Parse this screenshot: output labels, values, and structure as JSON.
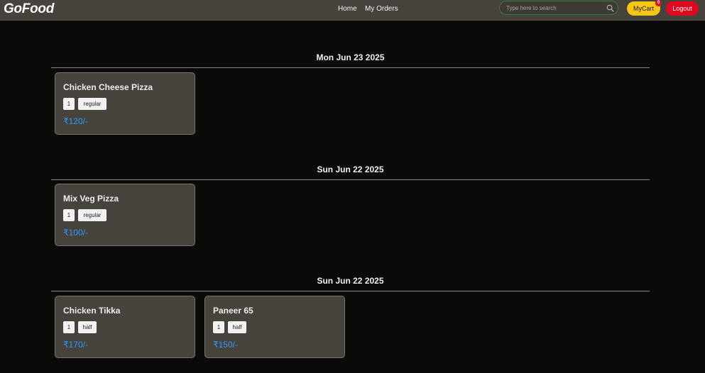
{
  "navbar": {
    "brand": "GoFood",
    "links": [
      "Home",
      "My Orders"
    ],
    "search_placeholder": "Type here to search",
    "cart_label": "MyCart",
    "cart_count": "0",
    "logout_label": "Logout"
  },
  "orders": [
    {
      "date": "Mon Jun 23 2025",
      "items": [
        {
          "name": "Chicken Cheese Pizza",
          "qty": "1",
          "size": "regular",
          "price": "₹120/-"
        }
      ]
    },
    {
      "date": "Sun Jun 22 2025",
      "items": [
        {
          "name": "Mix Veg Pizza",
          "qty": "1",
          "size": "regular",
          "price": "₹100/-"
        }
      ]
    },
    {
      "date": "Sun Jun 22 2025",
      "items": [
        {
          "name": "Chicken Tikka",
          "qty": "1",
          "size": "half",
          "price": "₹170/-"
        },
        {
          "name": "Paneer 65",
          "qty": "1",
          "size": "half",
          "price": "₹150/-"
        }
      ]
    }
  ]
}
